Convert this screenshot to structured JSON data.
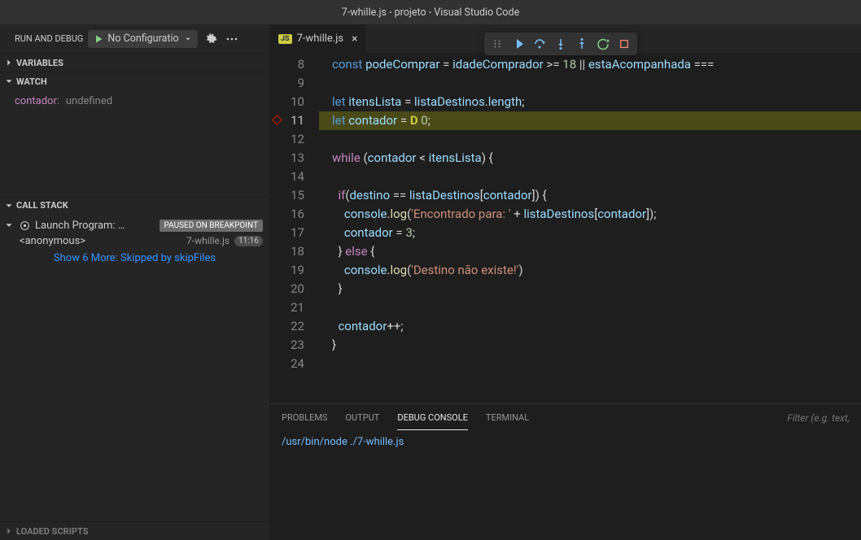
{
  "titlebar": "7-whille.js - projeto - Visual Studio Code",
  "sidebar": {
    "title": "RUN AND DEBUG",
    "config_label": "No Configuratio",
    "sections": {
      "variables": "VARIABLES",
      "watch": "WATCH",
      "callstack": "CALL STACK",
      "loaded_scripts": "LOADED SCRIPTS"
    },
    "watch": {
      "var": "contador",
      "sep": ":",
      "value": "undefined"
    },
    "callstack": {
      "program": "Launch Program: …",
      "paused": "PAUSED ON BREAKPOINT",
      "frame": "<anonymous>",
      "file": "7-whille.js",
      "pos": "11:16",
      "skip": "Show 6 More: Skipped by skipFiles"
    }
  },
  "tab": {
    "badge": "JS",
    "name": "7-whille.js"
  },
  "code": {
    "start": 8,
    "current": 11,
    "lines": [
      {
        "n": 8,
        "seg": [
          [
            "kw",
            "const"
          ],
          [
            "pl",
            " "
          ],
          [
            "ident",
            "podeComprar"
          ],
          [
            "pl",
            " "
          ],
          [
            "op",
            "="
          ],
          [
            "pl",
            " "
          ],
          [
            "ident",
            "idadeComprador"
          ],
          [
            "pl",
            " "
          ],
          [
            "op",
            ">="
          ],
          [
            "pl",
            " "
          ],
          [
            "num",
            "18"
          ],
          [
            "pl",
            " "
          ],
          [
            "op",
            "||"
          ],
          [
            "pl",
            " "
          ],
          [
            "ident",
            "estaAcompanhada"
          ],
          [
            "pl",
            " "
          ],
          [
            "op",
            "==="
          ]
        ]
      },
      {
        "n": 9,
        "seg": []
      },
      {
        "n": 10,
        "seg": [
          [
            "kw",
            "let"
          ],
          [
            "pl",
            " "
          ],
          [
            "ident",
            "itensLista"
          ],
          [
            "pl",
            " "
          ],
          [
            "op",
            "="
          ],
          [
            "pl",
            " "
          ],
          [
            "ident",
            "listaDestinos"
          ],
          [
            "pl",
            "."
          ],
          [
            "ident",
            "length"
          ],
          [
            "pl",
            ";"
          ]
        ]
      },
      {
        "n": 11,
        "hl": true,
        "seg": [
          [
            "kw",
            "let"
          ],
          [
            "pl",
            " "
          ],
          [
            "ident",
            "contador"
          ],
          [
            "pl",
            " "
          ],
          [
            "op",
            "="
          ],
          [
            "pl",
            " "
          ],
          [
            "cursor-mark",
            "D "
          ],
          [
            "num",
            "0"
          ],
          [
            "pl",
            ";"
          ]
        ]
      },
      {
        "n": 12,
        "seg": []
      },
      {
        "n": 13,
        "seg": [
          [
            "kw2",
            "while"
          ],
          [
            "pl",
            " ("
          ],
          [
            "ident",
            "contador"
          ],
          [
            "pl",
            " "
          ],
          [
            "op",
            "<"
          ],
          [
            "pl",
            " "
          ],
          [
            "ident",
            "itensLista"
          ],
          [
            "pl",
            ") {"
          ]
        ]
      },
      {
        "n": 14,
        "seg": []
      },
      {
        "n": 15,
        "seg": [
          [
            "pl",
            "  "
          ],
          [
            "kw2",
            "if"
          ],
          [
            "pl",
            "("
          ],
          [
            "ident",
            "destino"
          ],
          [
            "pl",
            " "
          ],
          [
            "op",
            "=="
          ],
          [
            "pl",
            " "
          ],
          [
            "ident",
            "listaDestinos"
          ],
          [
            "pl",
            "["
          ],
          [
            "ident",
            "contador"
          ],
          [
            "pl",
            "]) {"
          ]
        ]
      },
      {
        "n": 16,
        "seg": [
          [
            "pl",
            "    "
          ],
          [
            "ident",
            "console"
          ],
          [
            "pl",
            "."
          ],
          [
            "fn",
            "log"
          ],
          [
            "pl",
            "("
          ],
          [
            "str",
            "'Encontrado para: '"
          ],
          [
            "pl",
            " "
          ],
          [
            "op",
            "+"
          ],
          [
            "pl",
            " "
          ],
          [
            "ident",
            "listaDestinos"
          ],
          [
            "pl",
            "["
          ],
          [
            "ident",
            "contador"
          ],
          [
            "pl",
            "]);"
          ]
        ]
      },
      {
        "n": 17,
        "seg": [
          [
            "pl",
            "    "
          ],
          [
            "ident",
            "contador"
          ],
          [
            "pl",
            " "
          ],
          [
            "op",
            "="
          ],
          [
            "pl",
            " "
          ],
          [
            "num",
            "3"
          ],
          [
            "pl",
            ";"
          ]
        ]
      },
      {
        "n": 18,
        "seg": [
          [
            "pl",
            "  } "
          ],
          [
            "kw2",
            "else"
          ],
          [
            "pl",
            " {"
          ]
        ]
      },
      {
        "n": 19,
        "seg": [
          [
            "pl",
            "    "
          ],
          [
            "ident",
            "console"
          ],
          [
            "pl",
            "."
          ],
          [
            "fn",
            "log"
          ],
          [
            "pl",
            "("
          ],
          [
            "str",
            "'Destino não existe!'"
          ],
          [
            "pl",
            ")"
          ]
        ]
      },
      {
        "n": 20,
        "seg": [
          [
            "pl",
            "  }"
          ]
        ]
      },
      {
        "n": 21,
        "seg": []
      },
      {
        "n": 22,
        "seg": [
          [
            "pl",
            "  "
          ],
          [
            "ident",
            "contador"
          ],
          [
            "op",
            "++"
          ],
          [
            "pl",
            ";"
          ]
        ]
      },
      {
        "n": 23,
        "seg": [
          [
            "pl",
            "}"
          ]
        ]
      },
      {
        "n": 24,
        "seg": []
      }
    ]
  },
  "panel": {
    "tabs": {
      "problems": "PROBLEMS",
      "output": "OUTPUT",
      "debug_console": "DEBUG CONSOLE",
      "terminal": "TERMINAL"
    },
    "filter_placeholder": "Filter (e.g. text,",
    "console_line": "/usr/bin/node ./7-whille.js"
  }
}
